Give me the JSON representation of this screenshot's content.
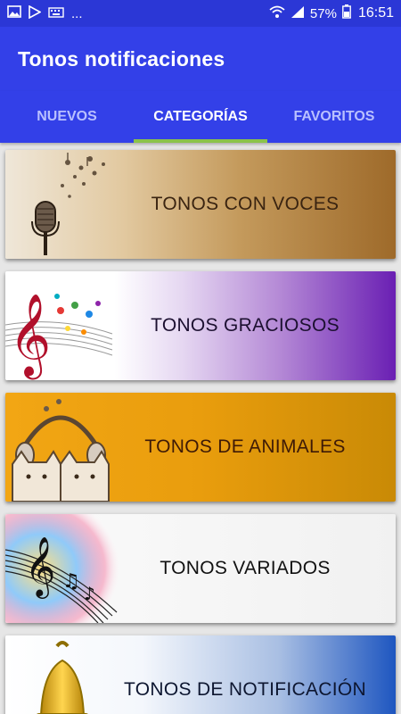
{
  "status_bar": {
    "left_icons": [
      "image-icon",
      "play-store-icon",
      "keyboard-icon"
    ],
    "more": "...",
    "battery": "57%",
    "time": "16:51"
  },
  "app_bar": {
    "title": "Tonos notificaciones"
  },
  "tabs": [
    {
      "label": "NUEVOS",
      "active": false
    },
    {
      "label": "CATEGORÍAS",
      "active": true
    },
    {
      "label": "FAVORITOS",
      "active": false
    }
  ],
  "categories": [
    {
      "label": "TONOS CON VOCES",
      "icon": "microphone-icon"
    },
    {
      "label": "TONOS GRACIOSOS",
      "icon": "treble-clef-icon"
    },
    {
      "label": "TONOS DE ANIMALES",
      "icon": "cats-headphones-icon"
    },
    {
      "label": "TONOS VARIADOS",
      "icon": "music-notes-icon"
    },
    {
      "label": "TONOS DE NOTIFICACIÓN",
      "icon": "bell-icon"
    }
  ],
  "colors": {
    "primary": "#3340e8",
    "status_bar": "#2b37d6",
    "tab_indicator": "#8bc34a"
  }
}
